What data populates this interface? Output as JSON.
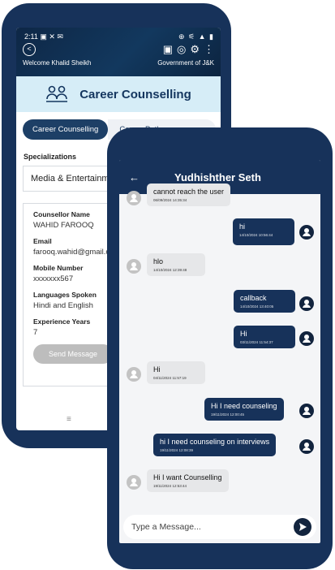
{
  "back_phone": {
    "status_time": "2:11",
    "status_left_icons": "▣ ✕ ✉",
    "status_right_icons": "⊕ ⚟ ▲ ▮",
    "welcome_text": "Welcome Khalid Sheikh",
    "govt_text": "Government of J&K",
    "banner_title": "Career Counselling",
    "tab_active": "Career Counselling",
    "tab_inactive": "Career Paths",
    "specializations_label": "Specializations",
    "specialization_value": "Media & Entertainment",
    "fields": [
      {
        "label": "Counsellor Name",
        "value": "WAHID FAROOQ"
      },
      {
        "label": "Email",
        "value": "farooq.wahid@gmail.com"
      },
      {
        "label": "Mobile Number",
        "value": "xxxxxxx567"
      },
      {
        "label": "Languages Spoken",
        "value": "Hindi and English"
      },
      {
        "label": "Experience Years",
        "value": "7"
      }
    ],
    "send_message_label": "Send Message",
    "menu_icon": "≡"
  },
  "chat": {
    "title": "Yudhishther Seth",
    "back_icon": "←",
    "messages": [
      {
        "dir": "in",
        "text": "cannot reach the user",
        "time": "06/09/2024 14:35:34"
      },
      {
        "dir": "out",
        "text": "hi",
        "time": "14/10/2024 10:56:44"
      },
      {
        "dir": "in",
        "text": "hlo",
        "time": "14/10/2024 12:39:48"
      },
      {
        "dir": "out",
        "text": "callback",
        "time": "14/10/2024 13:40:05"
      },
      {
        "dir": "out",
        "text": "Hi",
        "time": "03/11/2024 11:54:37"
      },
      {
        "dir": "in",
        "text": "Hi",
        "time": "04/11/2024 11:57:19"
      },
      {
        "dir": "out",
        "text": "Hi I need counseling",
        "time": "19/11/2024 12:00:45"
      },
      {
        "dir": "out",
        "text": "hi I need counseling on interviews",
        "time": "19/11/2024 12:08:39"
      },
      {
        "dir": "in",
        "text": "Hi I want Counselling",
        "time": "19/11/2024 12:53:44"
      }
    ],
    "input_placeholder": "Type a Message..."
  },
  "colors": {
    "navy": "#17325a",
    "banner": "#d6edf7",
    "bubble_in": "#e6e7e9"
  }
}
